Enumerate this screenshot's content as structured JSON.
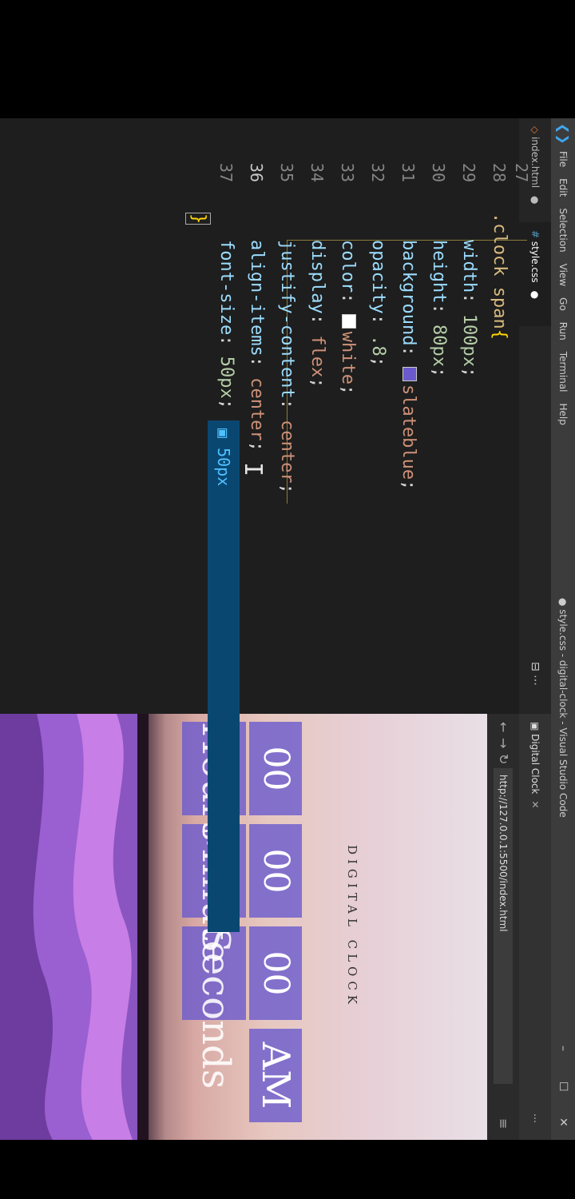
{
  "vscode": {
    "menu": [
      "File",
      "Edit",
      "Selection",
      "View",
      "Go",
      "Run",
      "Terminal",
      "Help"
    ],
    "window_title": "● style.css - digital-clock - Visual Studio Code",
    "window_controls": [
      "–",
      "☐",
      "✕"
    ],
    "tabs": [
      {
        "label": "index.html",
        "modified": true
      },
      {
        "label": "style.css",
        "modified": true
      }
    ],
    "editor_actions": "⊟ ⋯",
    "line_numbers": [
      "27",
      "28",
      "29",
      "30",
      "31",
      "32",
      "33",
      "34",
      "35",
      "36",
      "37"
    ],
    "current_line": "36",
    "code": {
      "selector": ".clock span",
      "open_brace": "{",
      "close_brace": "}",
      "declarations": [
        {
          "prop": "width",
          "value": "100px"
        },
        {
          "prop": "height",
          "value": "80px"
        },
        {
          "prop": "background",
          "value": "slateblue",
          "swatch": "#6a5acd"
        },
        {
          "prop": "opacity",
          "value": ".8"
        },
        {
          "prop": "color",
          "value": "white",
          "swatch": "#ffffff"
        },
        {
          "prop": "display",
          "value": "flex"
        },
        {
          "prop": "justify-content",
          "value": "center"
        },
        {
          "prop": "align-items",
          "value": "center"
        },
        {
          "prop": "font-size",
          "value": "50px"
        }
      ]
    },
    "suggestion": "50px"
  },
  "browser": {
    "tab_label": "Digital Clock",
    "tab_close": "✕",
    "url": "http://127.0.0.1:5500/index.html",
    "nav": [
      "←",
      "→",
      "↻"
    ],
    "page": {
      "title": "DIGITAL CLOCK",
      "hours": "00",
      "minutes": "00",
      "seconds": "00",
      "ampm": "AM",
      "labels": [
        "Hours",
        "Minute",
        "Seconds"
      ]
    }
  },
  "colors": {
    "accent": "#6a5acd",
    "editor_bg": "#1e1e1e",
    "suggest_bg": "#094771"
  }
}
